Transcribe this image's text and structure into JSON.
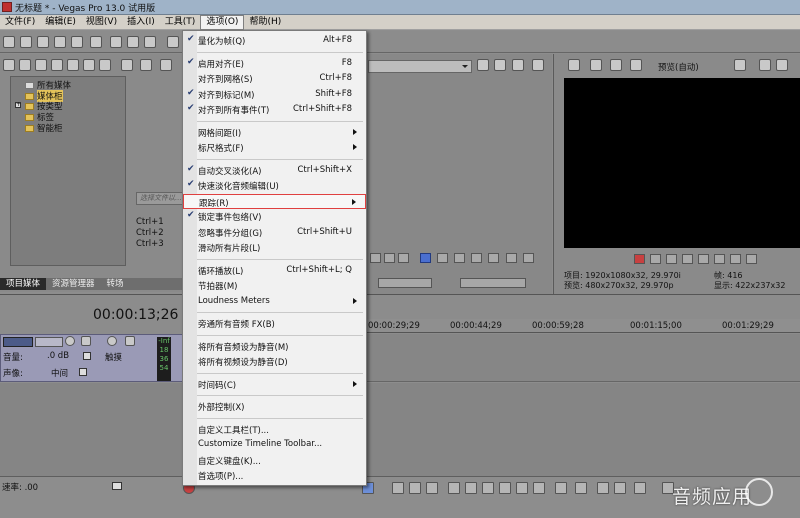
{
  "window": {
    "title": "无标题 * - Vegas Pro 13.0 试用版"
  },
  "menubar": [
    "文件(F)",
    "编辑(E)",
    "视图(V)",
    "插入(I)",
    "工具(T)",
    "选项(O)",
    "帮助(H)"
  ],
  "explorer": {
    "tree": [
      "所有媒体",
      "媒体柜",
      "按类型",
      "标签",
      "智能柜"
    ],
    "search_placeholder": "选择文件以...",
    "shortcuts": [
      "Ctrl+1",
      "Ctrl+2",
      "Ctrl+3"
    ],
    "tabs": [
      "项目媒体",
      "资源管理器",
      "转场"
    ]
  },
  "preview": {
    "mode_label": "预览(自动)",
    "info": [
      [
        "项目: 1920x1080x32, 29.970i",
        "帧:     416"
      ],
      [
        "预览: 480x270x32, 29.970p",
        "显示:  422x237x32"
      ]
    ]
  },
  "timeline": {
    "timecode": "00:00:13;26",
    "ruler": [
      "00:00:29;29",
      "00:00:44;29",
      "00:00:59;28",
      "00:01:15;00",
      "00:01:29;29"
    ]
  },
  "track": {
    "volume_label": "音量:",
    "volume_value": ".0 dB",
    "pan_label": "声像:",
    "pan_value": "中间",
    "touch_label": "触摸",
    "meter": [
      "-Inf",
      "18",
      "36",
      "54"
    ]
  },
  "bottom": {
    "rate_label": "速率: .00"
  },
  "watermark": "音频应用",
  "options_menu": {
    "items": [
      {
        "label": "量化为帧(Q)",
        "shortcut": "Alt+F8",
        "checked": true
      },
      {
        "sep": true
      },
      {
        "label": "启用对齐(E)",
        "shortcut": "F8",
        "checked": true
      },
      {
        "label": "对齐到网格(S)",
        "shortcut": "Ctrl+F8",
        "checked": false
      },
      {
        "label": "对齐到标记(M)",
        "shortcut": "Shift+F8",
        "checked": true
      },
      {
        "label": "对齐到所有事件(T)",
        "shortcut": "Ctrl+Shift+F8",
        "checked": true
      },
      {
        "sep": true
      },
      {
        "label": "网格间距(I)",
        "submenu": true
      },
      {
        "label": "标尺格式(F)",
        "submenu": true
      },
      {
        "sep": true
      },
      {
        "label": "自动交叉淡化(A)",
        "shortcut": "Ctrl+Shift+X",
        "checked": true
      },
      {
        "label": "快速淡化音频编辑(U)",
        "checked": true
      },
      {
        "label": "跟踪(R)",
        "submenu": true,
        "highlighted": true
      },
      {
        "label": "锁定事件包络(V)",
        "checked": true
      },
      {
        "label": "忽略事件分组(G)",
        "shortcut": "Ctrl+Shift+U"
      },
      {
        "label": "滑动所有片段(L)"
      },
      {
        "sep": true
      },
      {
        "label": "循环播放(L)",
        "shortcut": "Ctrl+Shift+L; Q"
      },
      {
        "label": "节拍器(M)"
      },
      {
        "label": "Loudness Meters",
        "submenu": true
      },
      {
        "sep": true
      },
      {
        "label": "旁通所有音频 FX(B)"
      },
      {
        "sep": true
      },
      {
        "label": "将所有音频设为静音(M)"
      },
      {
        "label": "将所有视频设为静音(D)"
      },
      {
        "sep": true
      },
      {
        "label": "时间码(C)",
        "submenu": true
      },
      {
        "sep": true
      },
      {
        "label": "外部控制(X)"
      },
      {
        "sep": true
      },
      {
        "label": "自定义工具栏(T)..."
      },
      {
        "label": "Customize Timeline Toolbar..."
      },
      {
        "label": "自定义键盘(K)..."
      },
      {
        "label": "首选项(P)..."
      }
    ]
  },
  "colors": {
    "menu_bg": "#f1f1f1",
    "highlight_border": "#e04040",
    "track_header": "#9a9ab6",
    "preview_screen": "#000000"
  }
}
